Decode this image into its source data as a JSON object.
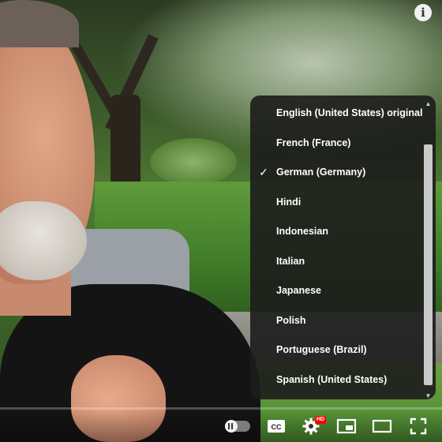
{
  "menu": {
    "items": [
      {
        "label": "English (United States) original",
        "selected": false
      },
      {
        "label": "French (France)",
        "selected": false
      },
      {
        "label": "German (Germany)",
        "selected": true
      },
      {
        "label": "Hindi",
        "selected": false
      },
      {
        "label": "Indonesian",
        "selected": false
      },
      {
        "label": "Italian",
        "selected": false
      },
      {
        "label": "Japanese",
        "selected": false
      },
      {
        "label": "Polish",
        "selected": false
      },
      {
        "label": "Portuguese (Brazil)",
        "selected": false
      },
      {
        "label": "Spanish (United States)",
        "selected": false
      }
    ]
  },
  "info_button": {
    "label": "i",
    "icon": "info-icon"
  },
  "controls": {
    "cc_label": "CC",
    "hd_badge": "HD",
    "icons": [
      "autoplay-toggle-icon",
      "captions-icon",
      "gear-icon",
      "miniplayer-icon",
      "theater-mode-icon",
      "fullscreen-icon"
    ]
  },
  "progress": {
    "played_fraction": 0.0
  },
  "colors": {
    "progress": "#ff0000",
    "hd_badge": "#ff0000",
    "menu_bg": "#1c1c1c"
  }
}
